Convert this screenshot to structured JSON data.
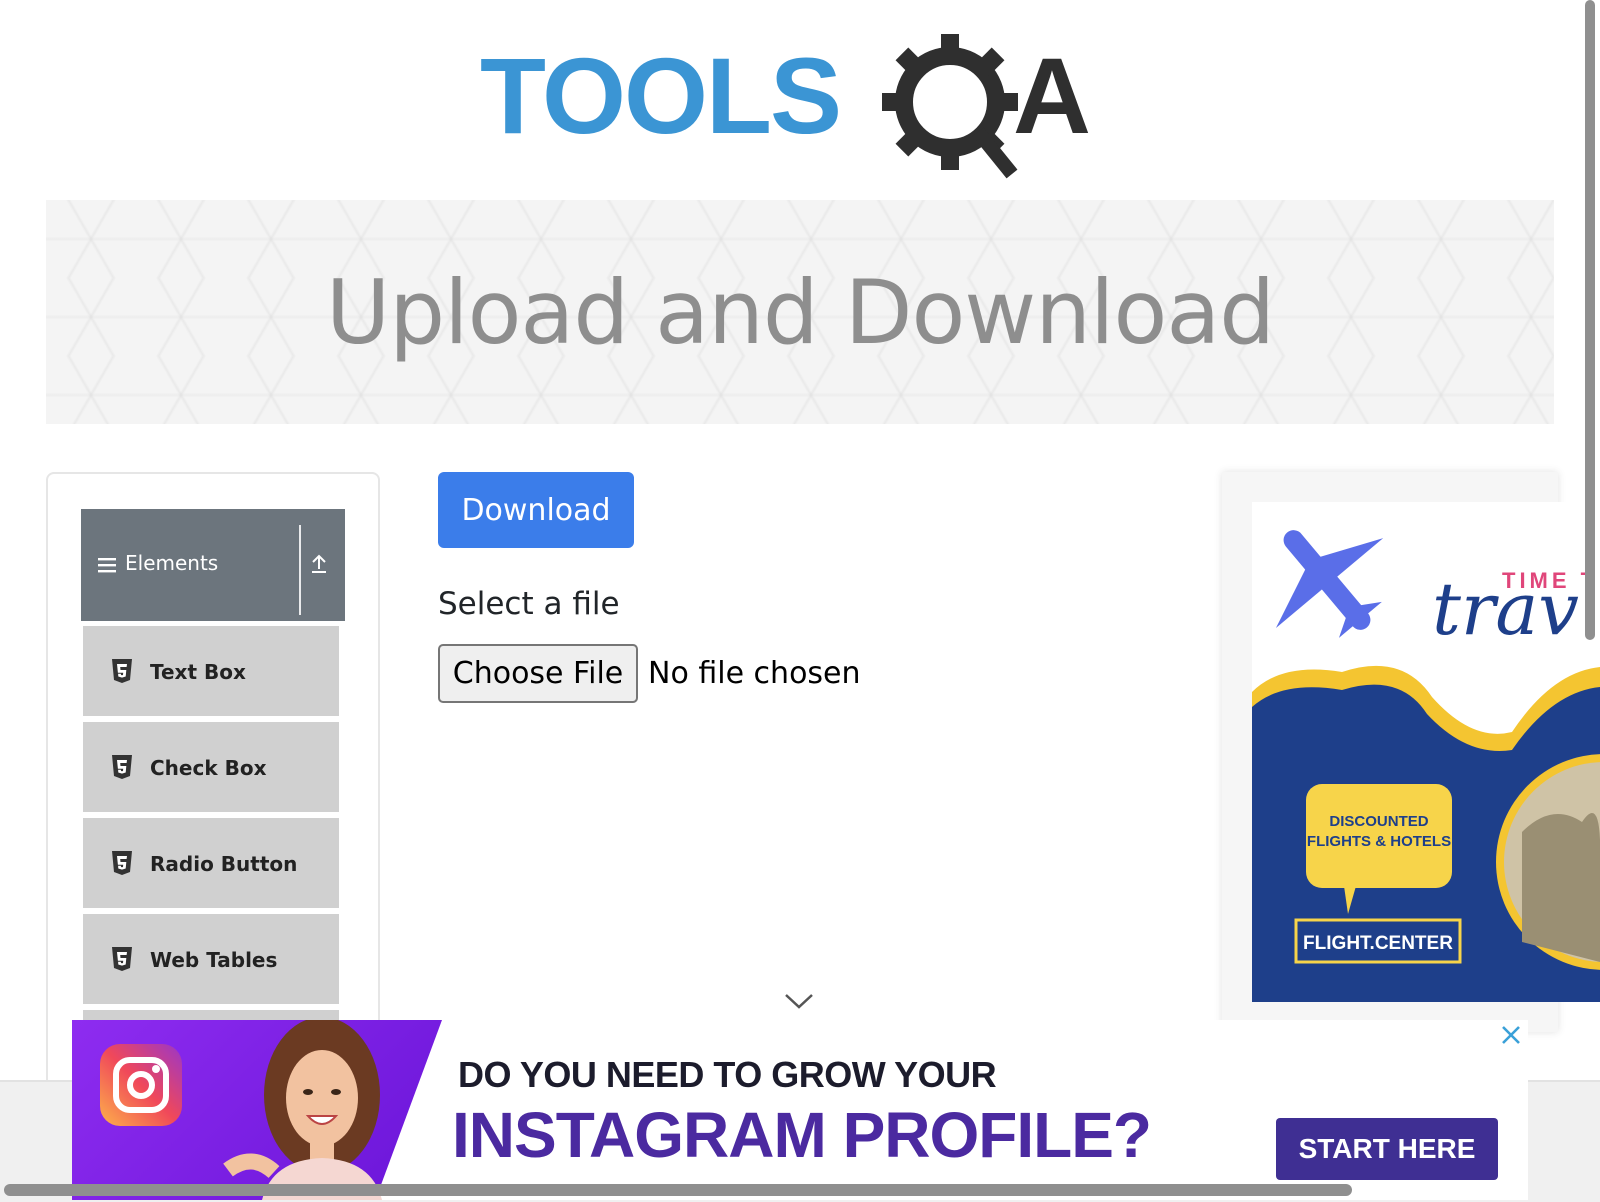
{
  "logo": {
    "alt": "ToolsQA",
    "text_left": "TOOLS",
    "text_right": "A"
  },
  "banner": {
    "title": "Upload and Download"
  },
  "sidebar": {
    "group_label": "Elements",
    "items": [
      {
        "label": "Text Box"
      },
      {
        "label": "Check Box"
      },
      {
        "label": "Radio Button"
      },
      {
        "label": "Web Tables"
      }
    ]
  },
  "main": {
    "download_label": "Download",
    "select_label": "Select a file",
    "choose_file_label": "Choose File",
    "no_file_text": "No file chosen"
  },
  "right_ad": {
    "title_small": "TIME T",
    "title_script": "trav",
    "bubble_text_1": "DISCOUNTED",
    "bubble_text_2": "FLIGHTS & HOTELS",
    "brand": "FLIGHT.CENTER"
  },
  "bottom_ad": {
    "line1": "DO YOU NEED TO GROW YOUR",
    "line2": "INSTAGRAM PROFILE?",
    "cta": "START HERE"
  },
  "colors": {
    "logo_blue": "#3b95d4",
    "logo_dark": "#333333",
    "download_button": "#3b7dea",
    "sidebar_header": "#6c757d",
    "sidebar_item": "#d0d0d0",
    "ad_purple": "#4b2aa0",
    "ad_navy": "#1e3f8a",
    "ad_yellow": "#f7d44a"
  },
  "icons": [
    "hamburger-icon",
    "collapse-arrow-icon",
    "html5-icon",
    "chevron-down-icon",
    "close-icon",
    "instagram-icon",
    "airplane-icon"
  ]
}
